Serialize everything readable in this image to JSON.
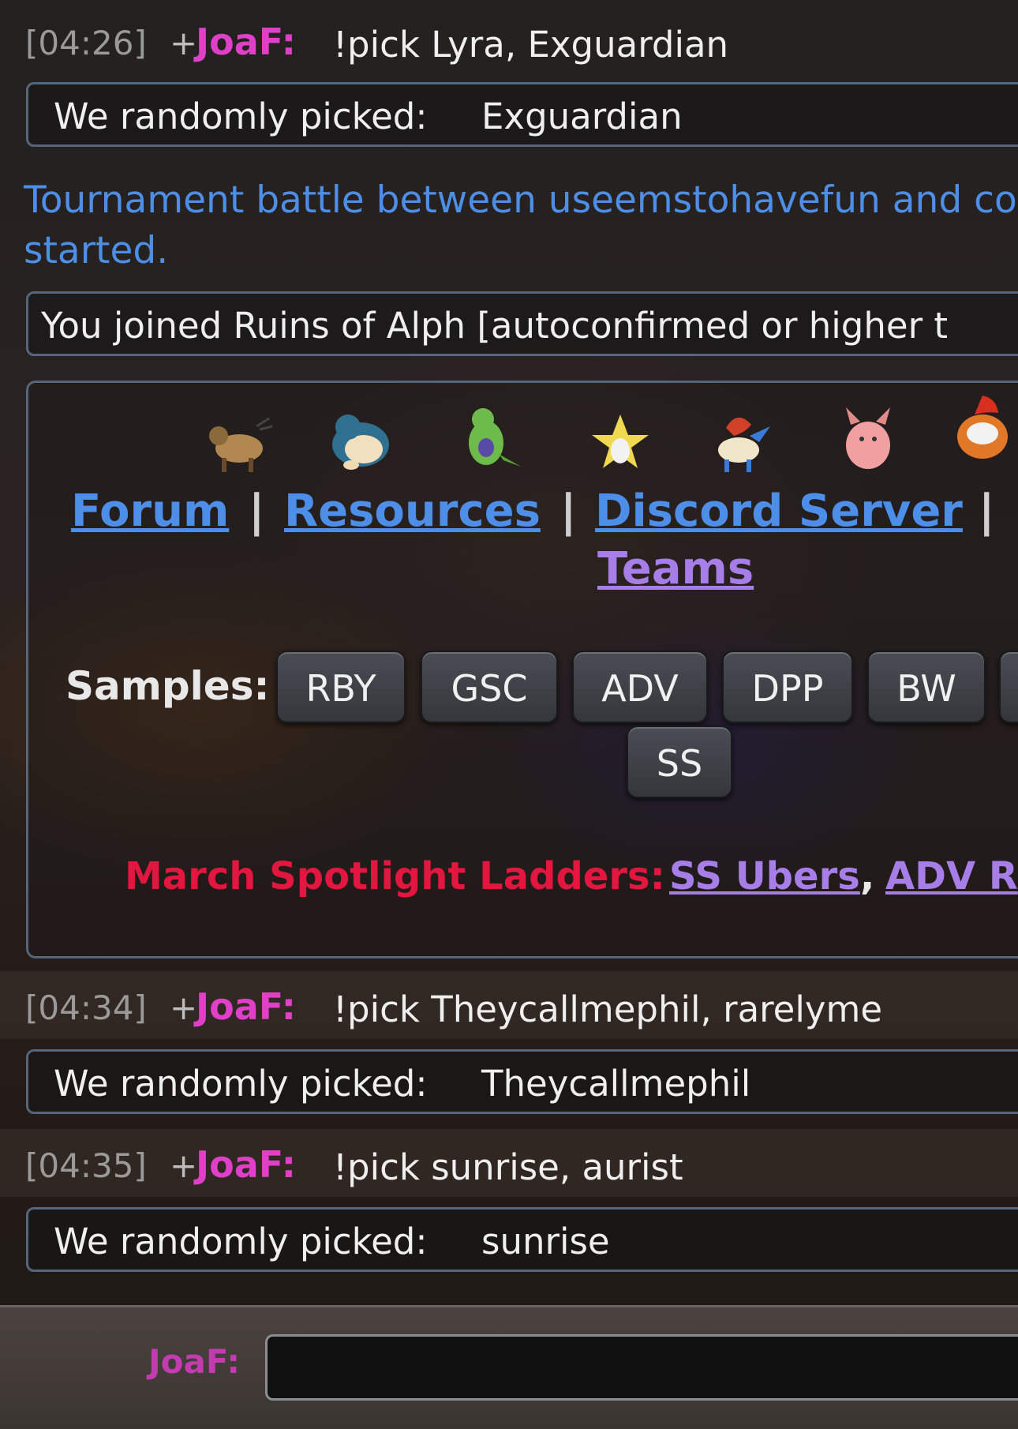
{
  "chat": [
    {
      "time": "[04:26]",
      "rank": "+",
      "user": "JoaF:",
      "message": "!pick Lyra, Exguardian",
      "result_label": "We randomly picked:",
      "result_value": "Exguardian"
    },
    {
      "time": "[04:34]",
      "rank": "+",
      "user": "JoaF:",
      "message": "!pick Theycallmephil, rarelyme",
      "result_label": "We randomly picked:",
      "result_value": "Theycallmephil"
    },
    {
      "time": "[04:35]",
      "rank": "+",
      "user": "JoaF:",
      "message": "!pick sunrise, aurist",
      "result_label": "We randomly picked:",
      "result_value": "sunrise"
    }
  ],
  "tournament_notice": {
    "line1": "Tournament battle between useemstohavefun and co",
    "line2": "started."
  },
  "join_notice": "You joined Ruins of Alph [autoconfirmed or higher t",
  "infobox": {
    "sprites": [
      "tauros-icon",
      "snorlax-icon",
      "tyranitar-icon",
      "jirachi-icon",
      "keldeo-icon",
      "clefable-icon",
      "infernape-icon"
    ],
    "links": {
      "forum": "Forum",
      "resources": "Resources",
      "discord": "Discord Server",
      "teams": "Teams"
    },
    "separator": "|",
    "samples_label": "Samples:",
    "samples": [
      "RBY",
      "GSC",
      "ADV",
      "DPP",
      "BW",
      "SS"
    ],
    "spotlight_label": "March Spotlight Ladders:",
    "spotlight_links": [
      "SS Ubers",
      "ADV R"
    ],
    "spotlight_comma": ","
  },
  "input": {
    "user_label": "JoaF:",
    "value": ""
  },
  "colors": {
    "username": "#e040c8",
    "link_blue": "#4d8fe8",
    "link_purple": "#a77ee8",
    "spotlight_red": "#e3163f",
    "box_border": "#56657a"
  }
}
